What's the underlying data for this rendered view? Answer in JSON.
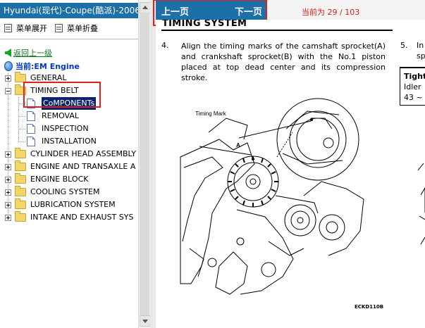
{
  "app": {
    "window_title": "Hyundai(现代)-Coupe(酷派)-2006"
  },
  "toolbar": {
    "expand_all": "菜单展开",
    "collapse_all": "菜单折叠"
  },
  "tree": {
    "back_label": "返回上一级",
    "current_label": "当前:EM Engine",
    "folders": [
      {
        "label": "GENERAL",
        "expanded": false
      },
      {
        "label": "TIMING BELT",
        "expanded": true
      },
      {
        "label": "CYLINDER HEAD ASSEMBLY",
        "expanded": false
      },
      {
        "label": "ENGINE AND TRANSAXLE A",
        "expanded": false
      },
      {
        "label": "ENGINE BLOCK",
        "expanded": false
      },
      {
        "label": "COOLING SYSTEM",
        "expanded": false
      },
      {
        "label": "LUBRICATION SYSTEM",
        "expanded": false
      },
      {
        "label": "INTAKE AND EXHAUST SYS",
        "expanded": false
      }
    ],
    "timing_belt_children": [
      "CoMPONENTs",
      "REMOVAL",
      "INSPECTION",
      "INSTALLATION"
    ],
    "selected_child": "CoMPONENTs"
  },
  "nav": {
    "prev_label": "上一页",
    "next_label": "下一页",
    "page_counter": "当前为 29 / 103"
  },
  "doc": {
    "section_title": "TIMING SYSTEM",
    "step4_num": "4.",
    "step4_text": "Align the timing marks of the camshaft sprocket(A) and crankshaft sprocket(B) with the No.1 piston placed at top dead center and its compression stroke.",
    "step5_num": "5.",
    "step5_text": "In",
    "step5_text2": "sp",
    "tighten_heading": "Tight",
    "tighten_line1": "Idler",
    "tighten_line2": "43 ~",
    "illustration_label_timing": "Timing Mark",
    "illustration_label_a": "A",
    "figure_code": "ECKD110B"
  },
  "colors": {
    "title_bar": "#1d6fa8",
    "highlight_box": "#e02020",
    "page_counter": "#d21d1d",
    "current_label": "#0037c0",
    "back_link": "#0a7a1e"
  }
}
